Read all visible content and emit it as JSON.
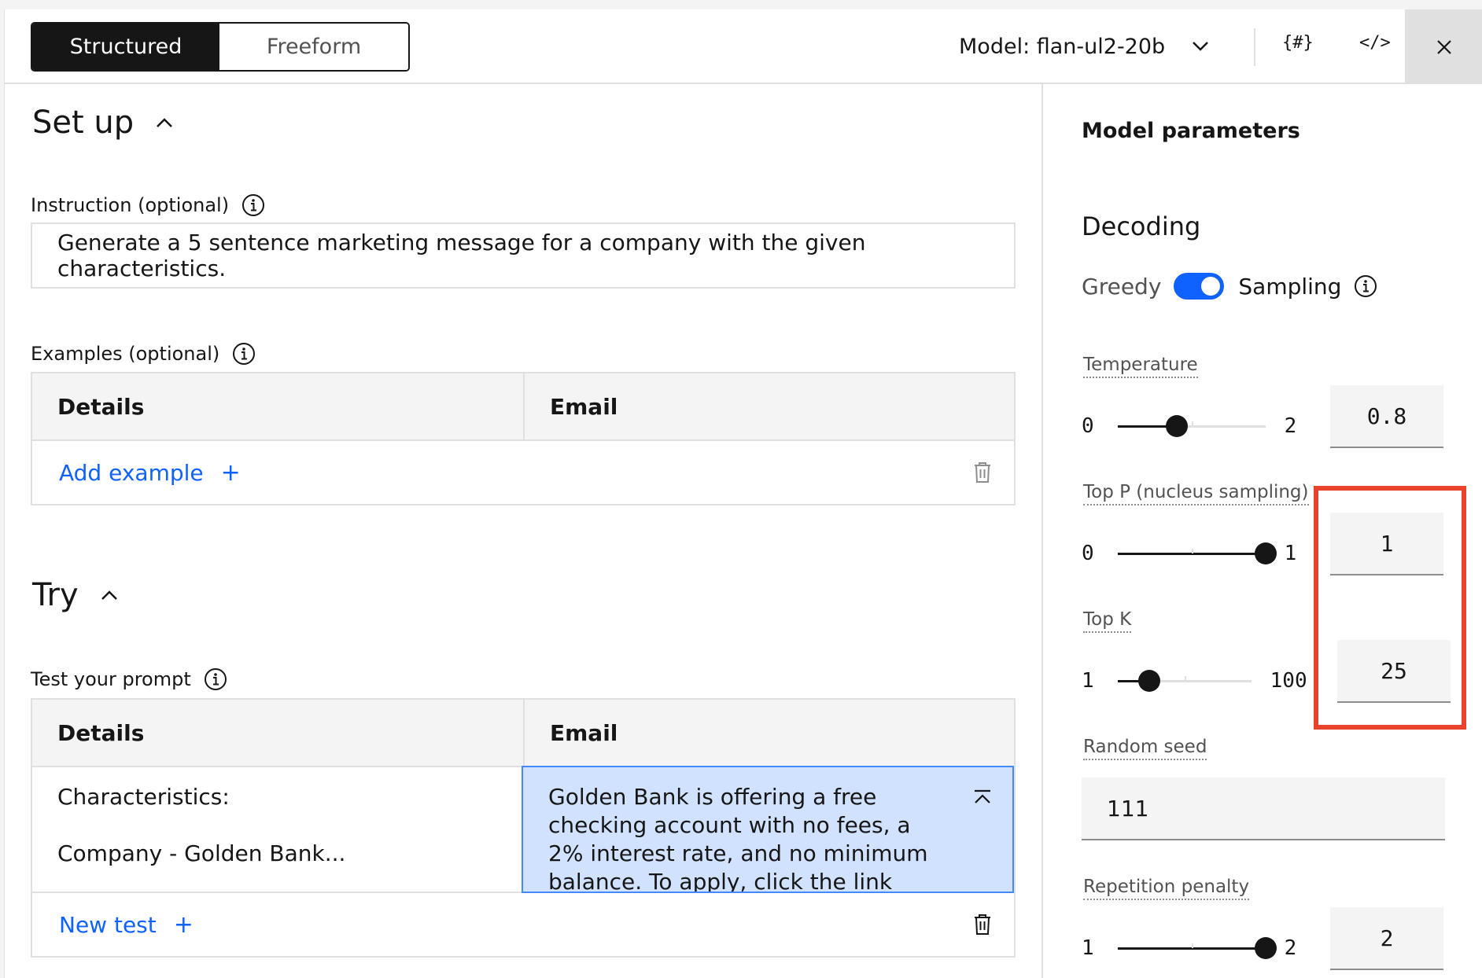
{
  "header": {
    "modes": [
      "Structured",
      "Freeform"
    ],
    "active_mode": "Structured",
    "model_label": "Model: flan-ul2-20b",
    "icons": [
      "tokens-icon",
      "code-icon",
      "close-icon"
    ],
    "token_icon_text": "{#}",
    "code_icon_text": "</>"
  },
  "setup": {
    "title": "Set up",
    "instruction_label": "Instruction (optional)",
    "instruction_value": "Generate a 5 sentence marketing message for a company with the given characteristics.",
    "examples_label": "Examples (optional)",
    "columns": [
      "Details",
      "Email"
    ],
    "add_example": "Add example",
    "plus": "+"
  },
  "try": {
    "title": "Try",
    "test_label": "Test your prompt",
    "columns": [
      "Details",
      "Email"
    ],
    "details_line1": "Characteristics:",
    "details_line2": "Company - Golden Bank...",
    "email_output": "Golden Bank is offering a free checking account with no fees, a 2% interest rate, and no minimum balance. To apply, click the link below. Offer ends",
    "new_test": "New test",
    "plus": "+"
  },
  "params": {
    "title": "Model parameters",
    "decoding_title": "Decoding",
    "toggle_off_label": "Greedy",
    "toggle_on_label": "Sampling",
    "toggle_state": "Sampling",
    "temperature": {
      "label": "Temperature",
      "min": "0",
      "max": "2",
      "value": "0.8",
      "fraction": 0.4
    },
    "top_p": {
      "label": "Top P (nucleus sampling)",
      "min": "0",
      "max": "1",
      "value": "1",
      "fraction": 1.0
    },
    "top_k": {
      "label": "Top K",
      "min": "1",
      "max": "100",
      "value": "25",
      "fraction": 0.24
    },
    "random_seed": {
      "label": "Random seed",
      "value": "111"
    },
    "repetition_penalty": {
      "label": "Repetition penalty",
      "min": "1",
      "max": "2",
      "value": "2",
      "fraction": 1.0
    }
  },
  "colors": {
    "accent": "#0f62fe",
    "highlight": "#e8412c",
    "selected_cell": "#d0e2ff"
  }
}
